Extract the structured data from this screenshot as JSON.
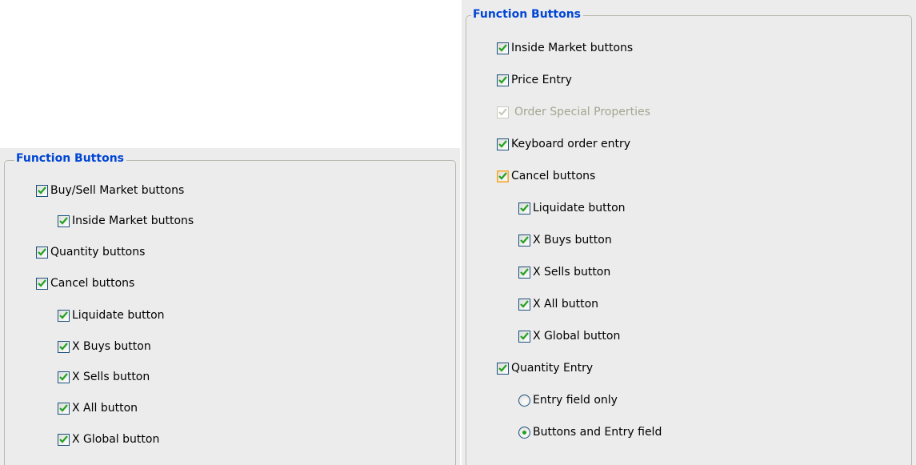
{
  "left_group": {
    "title": "Function Buttons",
    "items": [
      {
        "label": "Buy/Sell Market buttons",
        "checked": true
      },
      {
        "label": "Inside Market buttons",
        "checked": true
      },
      {
        "label": "Quantity buttons",
        "checked": true
      },
      {
        "label": "Cancel buttons",
        "checked": true
      },
      {
        "label": "Liquidate button",
        "checked": true
      },
      {
        "label": "X Buys button",
        "checked": true
      },
      {
        "label": "X Sells button",
        "checked": true
      },
      {
        "label": "X All button",
        "checked": true
      },
      {
        "label": "X Global button",
        "checked": true
      }
    ]
  },
  "right_group": {
    "title": "Function Buttons",
    "items": [
      {
        "label": "Inside Market buttons",
        "checked": true
      },
      {
        "label": "Price Entry",
        "checked": true
      },
      {
        "label": "Order Special Properties",
        "checked": true,
        "disabled": true
      },
      {
        "label": "Keyboard order entry",
        "checked": true
      },
      {
        "label": "Cancel buttons",
        "checked": true,
        "focused": true
      },
      {
        "label": "Liquidate button",
        "checked": true
      },
      {
        "label": "X Buys button",
        "checked": true
      },
      {
        "label": "X Sells button",
        "checked": true
      },
      {
        "label": "X All button",
        "checked": true
      },
      {
        "label": "X Global button",
        "checked": true
      },
      {
        "label": "Quantity Entry",
        "checked": true
      }
    ],
    "quantity_entry_options": [
      {
        "label": "Entry field only",
        "selected": false
      },
      {
        "label": "Buttons and Entry field",
        "selected": true
      }
    ]
  },
  "colors": {
    "legend_text": "#0046d5",
    "check_mark": "#21a121",
    "panel_bg": "#ececec",
    "disabled_text": "#a5a591",
    "focus_border": "#f2a533"
  },
  "icons": {
    "checkbox": "check-icon",
    "radio": "radio-dot-icon"
  }
}
